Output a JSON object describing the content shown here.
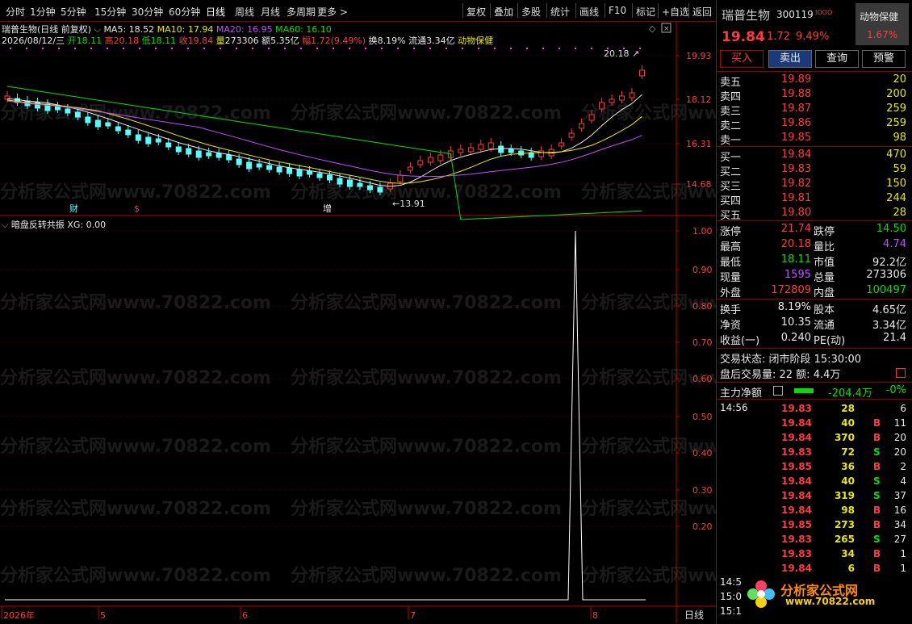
{
  "toolbar": {
    "items": [
      "分时",
      "1分钟",
      "5分钟",
      "15分钟",
      "30分钟",
      "60分钟",
      "日线",
      "周线",
      "月线",
      "多周期",
      "更多 >"
    ],
    "right_items": [
      "复权",
      "叠加",
      "多股",
      "统计",
      "画线",
      "F10",
      "标记",
      "+自选",
      "返回"
    ]
  },
  "header": {
    "stock_title": "瑞普生物(日线 前复权)",
    "ma5": "MA5: 18.52",
    "ma10": "MA10: 17.94",
    "ma20": "MA20: 16.95",
    "ma60": "MA60: 16.10",
    "date": "2026/08/12/三",
    "open_label": "开",
    "open": "18.11",
    "high_label": "高",
    "high": "20.18",
    "low_label": "低",
    "low": "18.11",
    "close_label": "收",
    "close": "19.84",
    "vol_label": "量",
    "vol": "273306",
    "amt_label": "额",
    "amt": "5.35亿",
    "range_label": "幅",
    "range": "1.72(9.49%)",
    "turnover": "换8.19%",
    "float": "流通3.34亿",
    "sector": "动物保健"
  },
  "price_axis": [
    "19.93",
    "18.12",
    "16.31",
    "14.68"
  ],
  "annotations": {
    "max": "20.18",
    "min": "13.91",
    "mark1": "财",
    "mark2": "$",
    "mark3": "增"
  },
  "indicator": {
    "title": "暗盘反转共振 XG: 0.00",
    "axis": [
      "1.00",
      "0.90",
      "0.80",
      "0.70",
      "0.60",
      "0.50",
      "0.40",
      "0.30",
      "0.20"
    ]
  },
  "date_axis": {
    "labels": [
      "2026年",
      "5",
      "6",
      "7",
      "8"
    ],
    "period": "日线"
  },
  "watermark": "分析家公式网www.70822.com",
  "right": {
    "name": "瑞普生物",
    "code": "300119",
    "sector_badge": "动物保健",
    "price": "19.84",
    "change": "1.72",
    "pct": "9.49%",
    "badge_pct": "1.67%",
    "buttons": [
      "买入",
      "卖出",
      "查询",
      "预警"
    ],
    "asks": [
      {
        "label": "卖五",
        "price": "19.89",
        "vol": "20"
      },
      {
        "label": "卖四",
        "price": "19.88",
        "vol": "200"
      },
      {
        "label": "卖三",
        "price": "19.87",
        "vol": "259"
      },
      {
        "label": "卖二",
        "price": "19.86",
        "vol": "259"
      },
      {
        "label": "卖一",
        "price": "19.85",
        "vol": "98"
      }
    ],
    "bids": [
      {
        "label": "买一",
        "price": "19.84",
        "vol": "470"
      },
      {
        "label": "买二",
        "price": "19.83",
        "vol": "59"
      },
      {
        "label": "买三",
        "price": "19.82",
        "vol": "150"
      },
      {
        "label": "买四",
        "price": "19.81",
        "vol": "244"
      },
      {
        "label": "买五",
        "price": "19.80",
        "vol": "28"
      }
    ],
    "stats": [
      {
        "l1": "涨停",
        "v1": "21.74",
        "l2": "跌停",
        "v2": "14.50"
      },
      {
        "l1": "最高",
        "v1": "20.18",
        "l2": "量比",
        "v2": "4.74"
      },
      {
        "l1": "最低",
        "v1": "18.11",
        "l2": "市值",
        "v2": "92.2亿"
      },
      {
        "l1": "现量",
        "v1": "1595",
        "l2": "总量",
        "v2": "273306"
      },
      {
        "l1": "外盘",
        "v1": "172809",
        "l2": "内盘",
        "v2": "100497"
      }
    ],
    "stats2": [
      {
        "l1": "换手",
        "v1": "8.19%",
        "l2": "股本",
        "v2": "4.65亿"
      },
      {
        "l1": "净资",
        "v1": "10.35",
        "l2": "流通",
        "v2": "3.34亿"
      },
      {
        "l1": "收益(一)",
        "v1": "0.240",
        "l2": "PE(动)",
        "v2": "21.4"
      }
    ],
    "status": "交易状态: 闭市阶段 15:30:00",
    "after": "盘后交易量: 22  额: 4.4万",
    "main_label": "主力净额",
    "main_value": "-204.4万",
    "main_pct": "-0%",
    "ticks_time": "14:56",
    "ticks": [
      {
        "p": "19.83",
        "v": "28",
        "d": "",
        "n": "6"
      },
      {
        "p": "19.84",
        "v": "40",
        "d": "B",
        "n": "11"
      },
      {
        "p": "19.84",
        "v": "370",
        "d": "B",
        "n": "20"
      },
      {
        "p": "19.83",
        "v": "72",
        "d": "S",
        "n": "20"
      },
      {
        "p": "19.85",
        "v": "36",
        "d": "B",
        "n": "2"
      },
      {
        "p": "19.84",
        "v": "40",
        "d": "S",
        "n": "4"
      },
      {
        "p": "19.84",
        "v": "319",
        "d": "S",
        "n": "37"
      },
      {
        "p": "19.84",
        "v": "98",
        "d": "B",
        "n": "16"
      },
      {
        "p": "19.85",
        "v": "273",
        "d": "B",
        "n": "34"
      },
      {
        "p": "19.83",
        "v": "265",
        "d": "S",
        "n": "27"
      },
      {
        "p": "19.83",
        "v": "34",
        "d": "B",
        "n": "1"
      },
      {
        "p": "19.84",
        "v": "6",
        "d": "B",
        "n": "1"
      }
    ],
    "bottom_times": [
      "14:5",
      "15:0",
      "15:1"
    ],
    "logo_text": "分析家公式网",
    "logo_url": "www.70822.com"
  }
}
